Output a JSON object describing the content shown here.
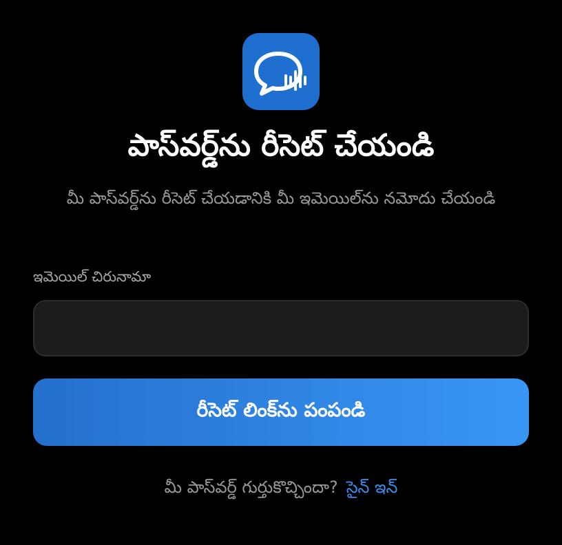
{
  "app": {
    "icon_name": "chat-bubble-waveform-icon",
    "accent_color": "#1e6fd0"
  },
  "page": {
    "title": "పాస్‌వర్డ్‌ను రీసెట్ చేయండి",
    "subtitle": "మీ పాస్‌వర్డ్‌ను రీసెట్ చేయడానికి మీ ఇమెయిల్‌ను నమోదు చేయండి"
  },
  "form": {
    "email_label": "ఇమెయిల్ చిరునామా",
    "email_value": "",
    "email_placeholder": "",
    "submit_label": "రీసెట్ లింక్‌ను పంపండి"
  },
  "footer": {
    "prompt": "మీ పాస్‌వర్డ్ గుర్తుకొచ్చిందా?",
    "signin_label": "సైన్ ఇన్",
    "link_color": "#3a8ff0"
  }
}
